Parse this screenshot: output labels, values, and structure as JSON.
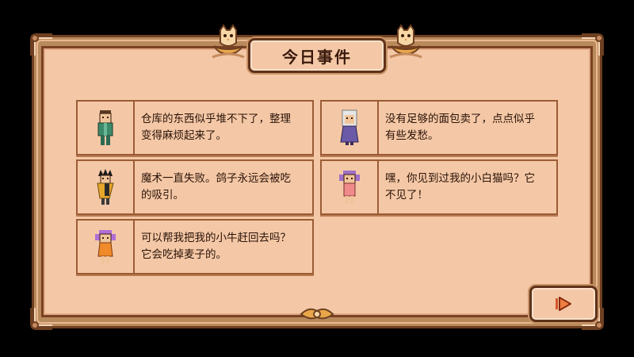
{
  "screen": {
    "title": "今日事件",
    "colors": {
      "parchment": "#f4c8a6",
      "frame_dark": "#5e3219",
      "card_border": "#9a5c36",
      "text": "#2a1208",
      "background": "#000000"
    }
  },
  "events": [
    {
      "character_icon": "villager-green-shirt",
      "text": "仓库的东西似乎堆不下了，整理\n变得麻烦起来了。"
    },
    {
      "character_icon": "villager-white-hair-purple-dress",
      "text": "没有足够的面包卖了，点点似乎\n有些发愁。"
    },
    {
      "character_icon": "villager-spiky-hair-yellow-cape",
      "text": "魔术一直失败。鸽子永远会被吃\n的吸引。"
    },
    {
      "character_icon": "villager-purple-pigtails-girl",
      "text": "嘿，你见到过我的小白猫吗？它\n不见了！"
    },
    {
      "character_icon": "villager-purple-pigtails-orange-dress",
      "text": "可以帮我把我的小牛赶回去吗？\n它会吃掉麦子的。"
    }
  ],
  "next_button": {
    "icon": "next-arrow-icon"
  }
}
